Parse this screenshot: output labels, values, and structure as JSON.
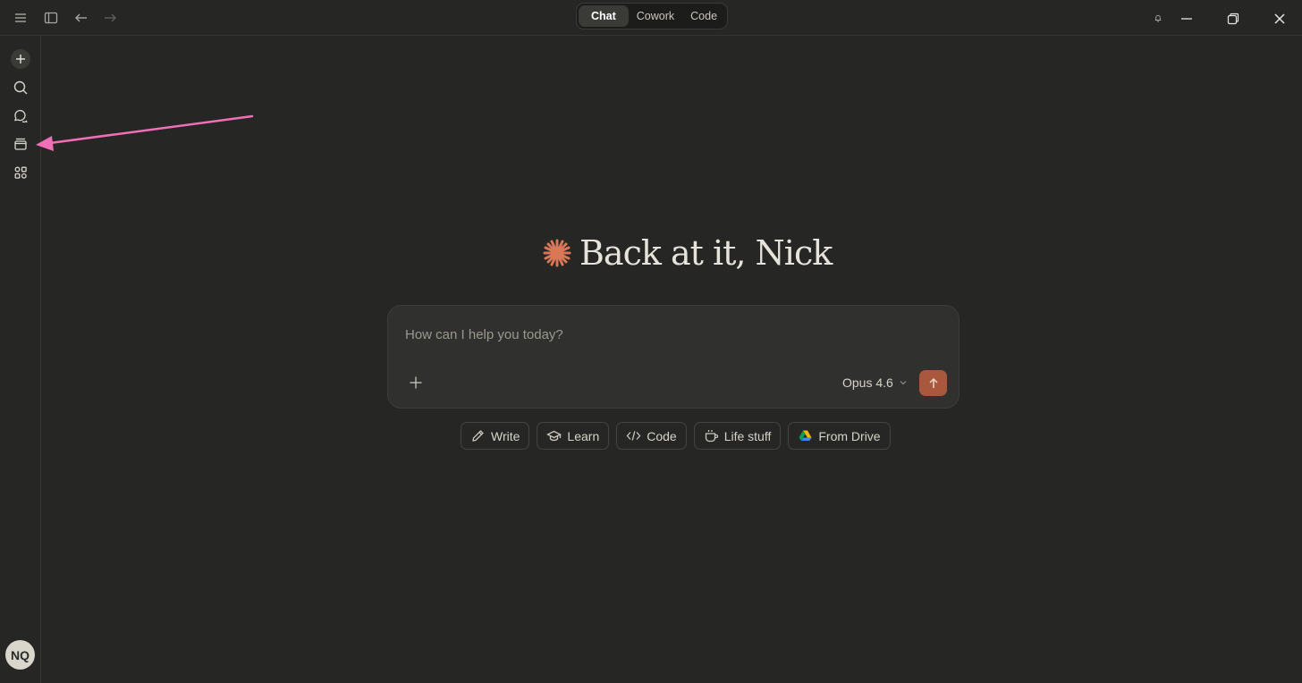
{
  "titlebar": {
    "modes": [
      {
        "label": "Chat",
        "active": true
      },
      {
        "label": "Cowork",
        "active": false
      },
      {
        "label": "Code",
        "active": false
      }
    ]
  },
  "sidebar": {
    "items": [
      {
        "name": "new-chat",
        "icon": "plus-icon"
      },
      {
        "name": "search",
        "icon": "search-icon"
      },
      {
        "name": "chats",
        "icon": "chat-bubbles-icon"
      },
      {
        "name": "projects",
        "icon": "archive-box-icon"
      },
      {
        "name": "artifacts",
        "icon": "shapes-icon"
      }
    ],
    "avatar_initials": "NQ"
  },
  "main": {
    "greeting": "Back at it, Nick",
    "composer": {
      "placeholder": "How can I help you today?",
      "model": "Opus 4.6"
    },
    "chips": [
      {
        "label": "Write",
        "icon": "pencil-icon"
      },
      {
        "label": "Learn",
        "icon": "graduation-cap-icon"
      },
      {
        "label": "Code",
        "icon": "code-icon"
      },
      {
        "label": "Life stuff",
        "icon": "coffee-cup-icon"
      },
      {
        "label": "From Drive",
        "icon": "google-drive-icon"
      }
    ]
  },
  "colors": {
    "background": "#262624",
    "accent": "#d97757",
    "send_button": "#a9583e",
    "annotation_arrow": "#f06fb7"
  }
}
